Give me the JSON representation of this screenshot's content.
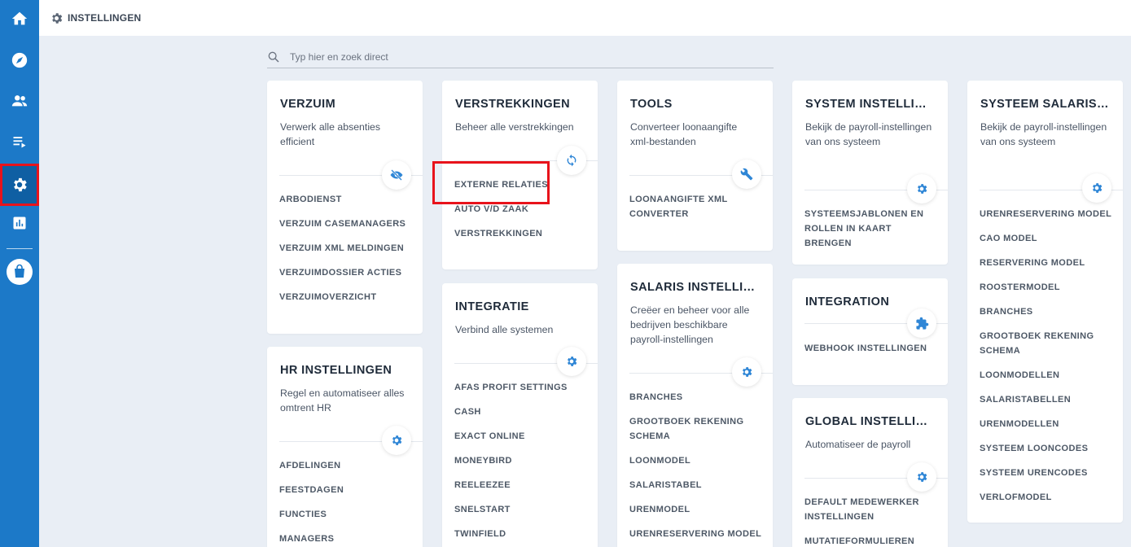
{
  "nav": {
    "items": [
      {
        "name": "home-icon"
      },
      {
        "name": "compass-icon"
      },
      {
        "name": "people-icon"
      },
      {
        "name": "playlist-icon"
      },
      {
        "name": "gear-icon",
        "active": true
      },
      {
        "name": "chart-icon"
      },
      {
        "name": "shopping-bag-icon"
      }
    ]
  },
  "header": {
    "title": "INSTELLINGEN"
  },
  "search": {
    "placeholder": "Typ hier en zoek direct"
  },
  "colors": {
    "sidebar": "#1c79c8",
    "accent": "#2f86d6",
    "highlight": "#e8131b",
    "background": "#e9eef5"
  },
  "cards": {
    "verzuim": {
      "title": "VERZUIM",
      "desc": "Verwerk alle absenties efficient",
      "icon": "eye-off-icon",
      "links": [
        "ARBODIENST",
        "VERZUIM CASEMANAGERS",
        "VERZUIM XML MELDINGEN",
        "VERZUIMDOSSIER ACTIES",
        "VERZUIMOVERZICHT"
      ]
    },
    "hr": {
      "title": "HR INSTELLINGEN",
      "desc": "Regel en automatiseer alles omtrent HR",
      "icon": "gear-icon",
      "links": [
        "AFDELINGEN",
        "FEESTDAGEN",
        "FUNCTIES",
        "MANAGERS"
      ]
    },
    "verstrekkingen": {
      "title": "VERSTREKKINGEN",
      "desc": "Beheer alle verstrekkingen",
      "icon": "sync-icon",
      "links": [
        "EXTERNE RELATIES",
        "AUTO V/D ZAAK",
        "VERSTREKKINGEN"
      ]
    },
    "integratie": {
      "title": "INTEGRATIE",
      "desc": "Verbind alle systemen",
      "icon": "gear-icon",
      "links": [
        "AFAS PROFIT SETTINGS",
        "CASH",
        "EXACT ONLINE",
        "MONEYBIRD",
        "REELEEZEE",
        "SNELSTART",
        "TWINFIELD"
      ]
    },
    "tools": {
      "title": "TOOLS",
      "desc": "Converteer loonaangifte xml-bestanden",
      "icon": "wrench-icon",
      "links": [
        "LOONAANGIFTE XML CONVERTER"
      ]
    },
    "salaris": {
      "title": "SALARIS INSTELLINGEN",
      "desc": "Creëer en beheer voor alle bedrijven beschikbare payroll-instellingen",
      "icon": "gear-icon",
      "links": [
        "BRANCHES",
        "GROOTBOEK REKENING SCHEMA",
        "LOONMODEL",
        "SALARISTABEL",
        "URENMODEL",
        "URENRESERVERING MODEL"
      ]
    },
    "system": {
      "title": "SYSTEM INSTELLINGEN",
      "desc": "Bekijk de payroll-instellingen van ons systeem",
      "icon": "gear-icon",
      "links": [
        "SYSTEEMSJABLONEN EN ROLLEN IN KAART BRENGEN"
      ]
    },
    "integration": {
      "title": "INTEGRATION",
      "icon": "puzzle-icon",
      "links": [
        "WEBHOOK INSTELLINGEN"
      ]
    },
    "global": {
      "title": "GLOBAL INSTELLINGEN",
      "desc": "Automatiseer de payroll",
      "icon": "gear-icon",
      "links": [
        "DEFAULT MEDEWERKER INSTELLINGEN",
        "MUTATIEFORMULIEREN"
      ]
    },
    "systeem_salaris": {
      "title": "SYSTEEM SALARISINSTELLINGEN",
      "desc": "Bekijk de payroll-instellingen van ons systeem",
      "icon": "gear-icon",
      "links": [
        "URENRESERVERING MODEL",
        "CAO MODEL",
        "RESERVERING MODEL",
        "ROOSTERMODEL",
        "BRANCHES",
        "GROOTBOEK REKENING SCHEMA",
        "LOONMODELLEN",
        "SALARISTABELLEN",
        "URENMODELLEN",
        "SYSTEEM LOONCODES",
        "SYSTEEM URENCODES",
        "VERLOFMODEL"
      ]
    }
  }
}
